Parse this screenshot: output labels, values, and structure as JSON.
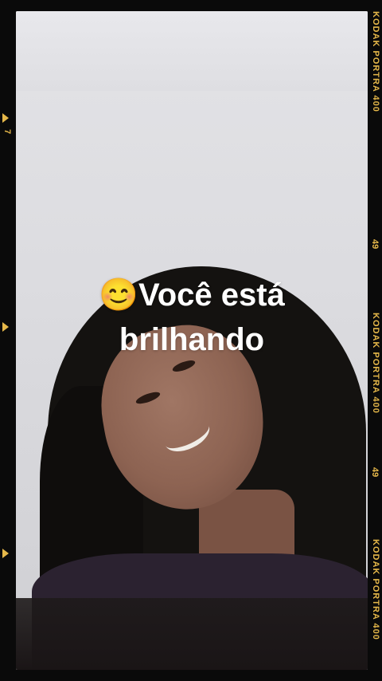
{
  "caption": {
    "emoji": "😊",
    "line1": "Você está",
    "line2": "brilhando"
  },
  "film_strip": {
    "brand_labels": [
      "KODAK PORTRA 400",
      "KODAK PORTRA 400",
      "KODAK PORTRA 400"
    ],
    "frame_numbers": [
      "49",
      "49"
    ],
    "left_number": "7",
    "accent_color": "#e6b84a"
  }
}
